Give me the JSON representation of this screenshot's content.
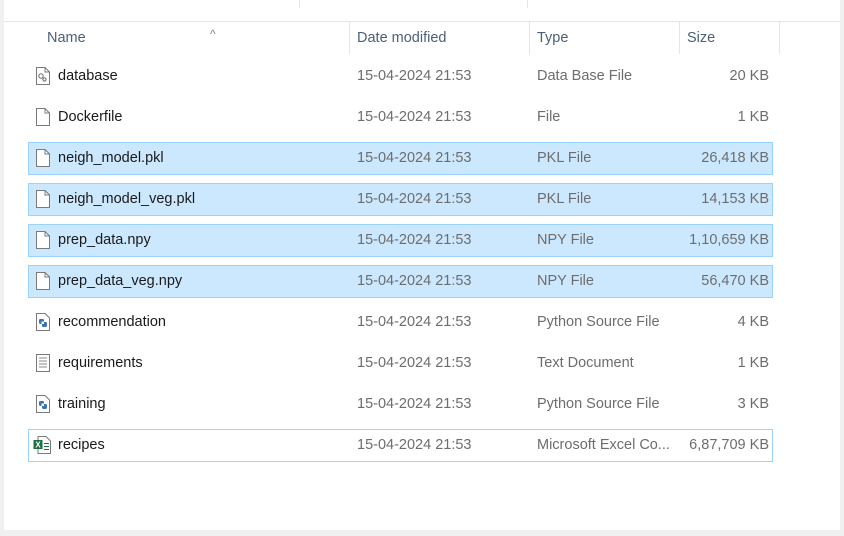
{
  "columns": {
    "name": "Name",
    "date": "Date modified",
    "type": "Type",
    "size": "Size"
  },
  "files": [
    {
      "name": "database",
      "date": "15-04-2024 21:53",
      "type": "Data Base File",
      "size": "20 KB",
      "icon": "database-file-icon",
      "selected": false
    },
    {
      "name": "Dockerfile",
      "date": "15-04-2024 21:53",
      "type": "File",
      "size": "1 KB",
      "icon": "generic-file-icon",
      "selected": false
    },
    {
      "name": "neigh_model.pkl",
      "date": "15-04-2024 21:53",
      "type": "PKL File",
      "size": "26,418 KB",
      "icon": "generic-file-icon",
      "selected": true
    },
    {
      "name": "neigh_model_veg.pkl",
      "date": "15-04-2024 21:53",
      "type": "PKL File",
      "size": "14,153 KB",
      "icon": "generic-file-icon",
      "selected": true
    },
    {
      "name": "prep_data.npy",
      "date": "15-04-2024 21:53",
      "type": "NPY File",
      "size": "1,10,659 KB",
      "icon": "generic-file-icon",
      "selected": true
    },
    {
      "name": "prep_data_veg.npy",
      "date": "15-04-2024 21:53",
      "type": "NPY File",
      "size": "56,470 KB",
      "icon": "generic-file-icon",
      "selected": true
    },
    {
      "name": "recommendation",
      "date": "15-04-2024 21:53",
      "type": "Python Source File",
      "size": "4 KB",
      "icon": "python-file-icon",
      "selected": false
    },
    {
      "name": "requirements",
      "date": "15-04-2024 21:53",
      "type": "Text Document",
      "size": "1 KB",
      "icon": "text-file-icon",
      "selected": false
    },
    {
      "name": "training",
      "date": "15-04-2024 21:53",
      "type": "Python Source File",
      "size": "3 KB",
      "icon": "python-file-icon",
      "selected": false
    },
    {
      "name": "recipes",
      "date": "15-04-2024 21:53",
      "type": "Microsoft Excel Co...",
      "size": "6,87,709 KB",
      "icon": "excel-file-icon",
      "selected": false,
      "focused": true
    }
  ],
  "colors": {
    "selection_bg": "#cce8ff",
    "selection_border": "#99d1ff",
    "header_text": "#4c607a"
  }
}
